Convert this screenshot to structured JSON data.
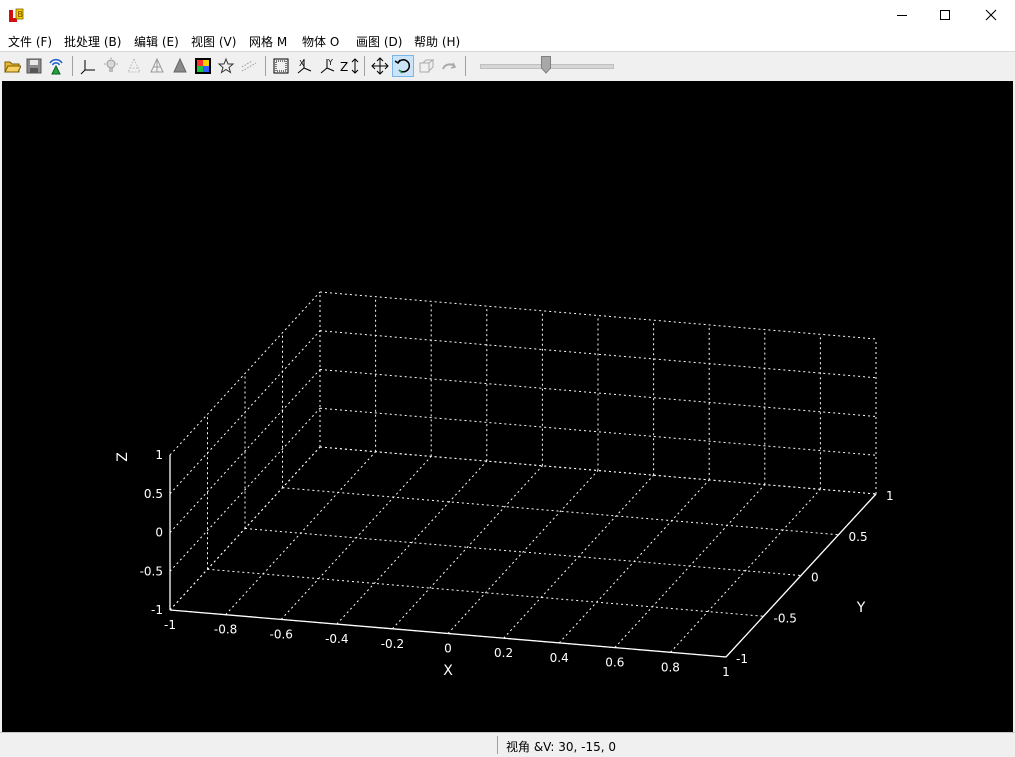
{
  "window": {
    "icon": "app-logo-icon",
    "controls": {
      "minimize": "minimize-icon",
      "maximize": "maximize-icon",
      "close": "close-icon"
    }
  },
  "menu": [
    {
      "label": "文件 (F)"
    },
    {
      "label": "批处理 (B)"
    },
    {
      "label": "编辑 (E)"
    },
    {
      "label": "视图 (V)"
    },
    {
      "label": "网格 M"
    },
    {
      "label": "物体 O"
    },
    {
      "label": "画图 (D)"
    },
    {
      "label": "帮助 (H)"
    }
  ],
  "toolbar": {
    "icons": [
      "open-folder-icon",
      "save-icon",
      "wireless-icon",
      "axes-icon",
      "light-icon",
      "mesh-cone-icon",
      "wireframe-cone-icon",
      "solid-cone-icon",
      "color-map-icon",
      "star-icon",
      "points-icon",
      "bounding-box-icon",
      "x-axis-icon",
      "y-axis-icon",
      "z-axis-icon",
      "pan-icon",
      "rotate-icon",
      "zoom-icon",
      "reset-icon"
    ],
    "slider_value": 0.5
  },
  "plot": {
    "colors": {
      "background": "#000000",
      "axis": "#ffffff",
      "grid": "#ffffff"
    },
    "z_label": "Z",
    "z_ticks": [
      "1",
      "0.5",
      "0",
      "-0.5",
      "-1"
    ],
    "x_label": "X",
    "x_ticks": [
      "-1",
      "-0.8",
      "-0.6",
      "-0.4",
      "-0.2",
      "0",
      "0.2",
      "0.4",
      "0.6",
      "0.8",
      "1"
    ],
    "y_label": "Y",
    "y_ticks": [
      "-1",
      "-0.5",
      "0",
      "0.5",
      "1"
    ]
  },
  "status": {
    "text": "视角 &V: 30, -15, 0"
  }
}
